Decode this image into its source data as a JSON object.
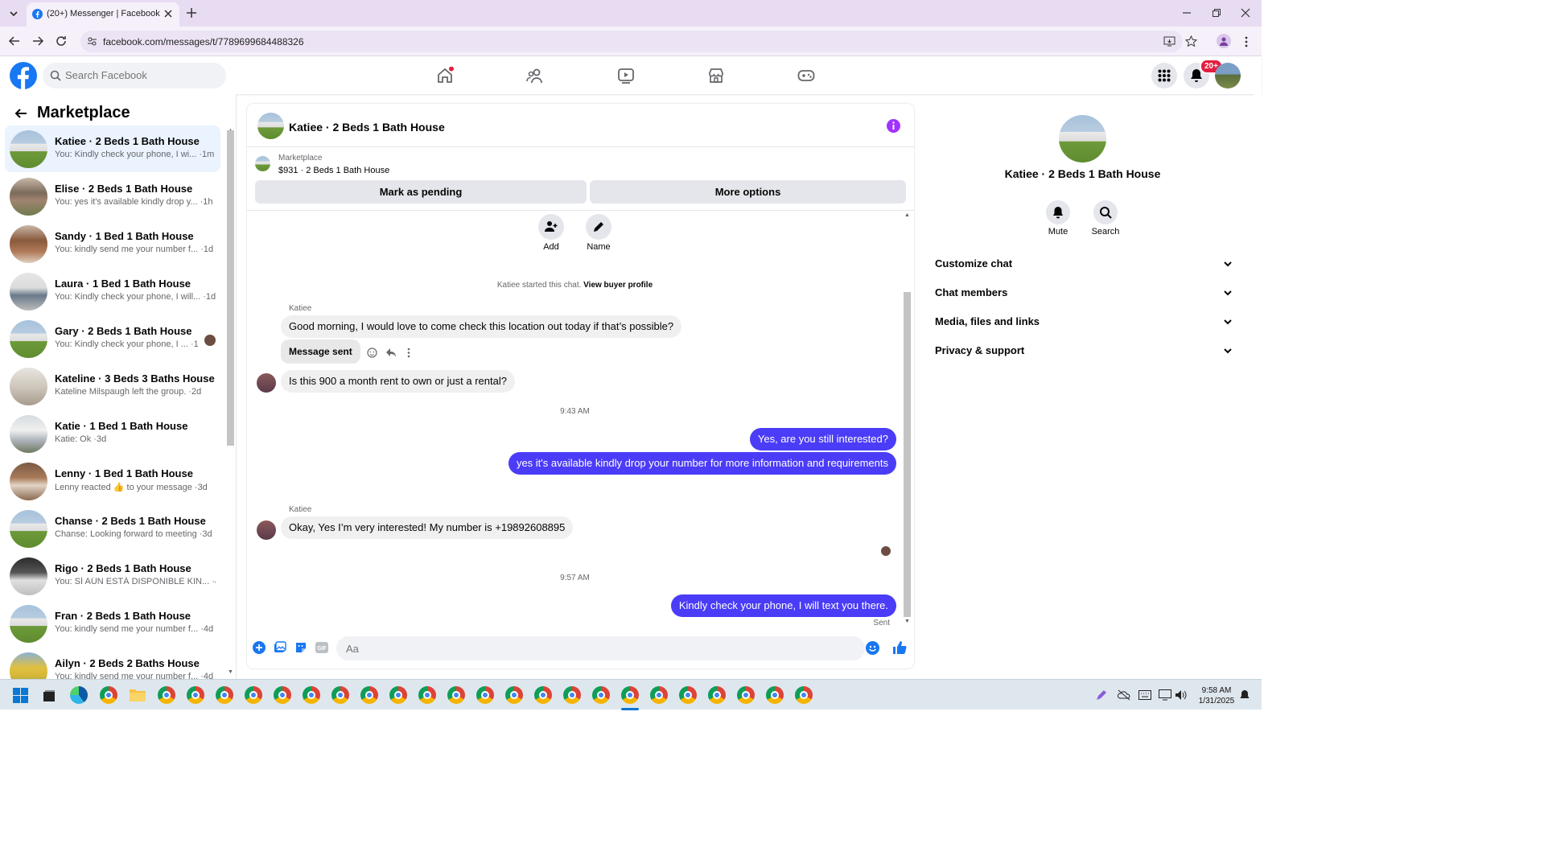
{
  "browser": {
    "tab_title": "(20+) Messenger | Facebook",
    "url": "facebook.com/messages/t/7789699684488326"
  },
  "fb": {
    "search_placeholder": "Search Facebook",
    "notification_count": "20+",
    "brand_color": "#1877f2"
  },
  "marketplace": {
    "title": "Marketplace",
    "conversations": [
      {
        "name": "Katiee · 2 Beds 1 Bath House",
        "snippet": "You: Kindly check your phone, I wi... ·1m",
        "active": true
      },
      {
        "name": "Elise · 2 Beds 1 Bath House",
        "snippet": "You: yes it's available kindly drop y... ·1h"
      },
      {
        "name": "Sandy · 1 Bed 1 Bath House",
        "snippet": "You: kindly send me your number f... ·1d"
      },
      {
        "name": "Laura · 1 Bed 1 Bath House",
        "snippet": "You: Kindly check your phone, I will... ·1d"
      },
      {
        "name": "Gary · 2 Beds 1 Bath House",
        "snippet": "You: Kindly check your phone, I ... ·1d"
      },
      {
        "name": "Kateline · 3 Beds 3 Baths House",
        "snippet": "Kateline Milspaugh left the group. ·2d"
      },
      {
        "name": "Katie · 1 Bed 1 Bath House",
        "snippet": "Katie: Ok ·3d"
      },
      {
        "name": "Lenny · 1 Bed 1 Bath House",
        "snippet": "Lenny reacted 👍 to your message ·3d"
      },
      {
        "name": "Chanse · 2 Beds 1 Bath House",
        "snippet": "Chanse: Looking forward to meeting ·3d"
      },
      {
        "name": "Rigo · 2 Beds 1 Bath House",
        "snippet": "You: SÍ AÚN ESTÁ DISPONIBLE KIN... ·4d"
      },
      {
        "name": "Fran · 2 Beds 1 Bath House",
        "snippet": "You: kindly send me your number f... ·4d"
      },
      {
        "name": "Ailyn · 2 Beds 2 Baths House",
        "snippet": "You: kindly send me your number f... ·4d"
      }
    ]
  },
  "chat": {
    "title": "Katiee · 2 Beds 1 Bath House",
    "listing_source": "Marketplace",
    "listing_title": "$931 · 2 Beds 1 Bath House",
    "mark_pending": "Mark as pending",
    "more_options": "More options",
    "add_label": "Add",
    "name_label": "Name",
    "started_text": "Katiee started this chat.",
    "view_profile": "View buyer profile",
    "sender_name": "Katiee",
    "msg1": "Good morning, I would love to come check this location out today if that’s possible?",
    "msg_sent": "Message sent",
    "msg2": "Is this 900 a month rent to own or just a rental?",
    "time1": "9:43 AM",
    "out1": "Yes, are you still interested?",
    "out2": "yes it's available kindly drop your number for more information and requirements",
    "msg3": "Okay, Yes I’m very interested! My number is +19892608895",
    "time2": "9:57 AM",
    "out3": "Kindly check your phone, I will text you there.",
    "sent_status": "Sent",
    "input_placeholder": "Aa",
    "outgoing_color": "#4a3cf7"
  },
  "details": {
    "name": "Katiee · 2 Beds 1 Bath House",
    "mute": "Mute",
    "search": "Search",
    "sections": [
      "Customize chat",
      "Chat members",
      "Media, files and links",
      "Privacy & support"
    ]
  },
  "taskbar": {
    "time": "9:58 AM",
    "date": "1/31/2025"
  }
}
